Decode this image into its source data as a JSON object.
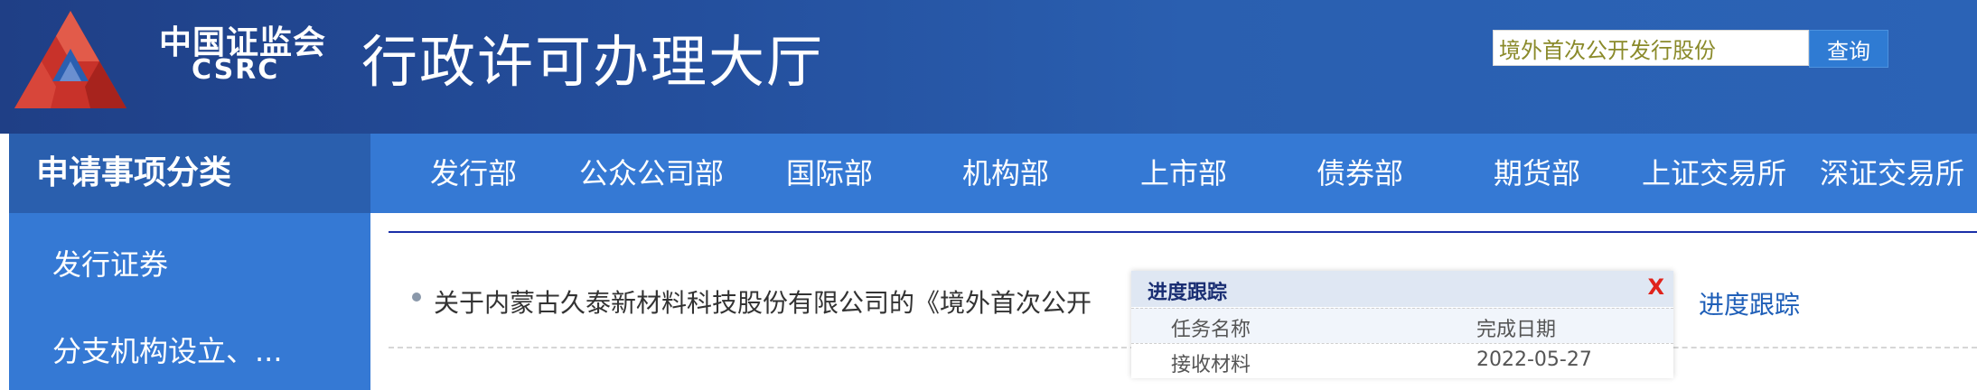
{
  "header": {
    "logo_cn": "中国证监会",
    "logo_en": "CSRC",
    "site_title": "行政许可办理大厅",
    "search": {
      "value": "境外首次公开发行股份",
      "button_label": "查询"
    }
  },
  "sidebar": {
    "title": "申请事项分类",
    "items": [
      {
        "label": "发行证券"
      },
      {
        "label": "分支机构设立、..."
      }
    ]
  },
  "nav": {
    "items": [
      {
        "label": "发行部"
      },
      {
        "label": "公众公司部"
      },
      {
        "label": "国际部"
      },
      {
        "label": "机构部"
      },
      {
        "label": "上市部"
      },
      {
        "label": "债券部"
      },
      {
        "label": "期货部"
      },
      {
        "label": "上证交易所"
      },
      {
        "label": "深证交易所"
      }
    ]
  },
  "content": {
    "item_title": "关于内蒙古久泰新材料科技股份有限公司的《境外首次公开",
    "track_link": "进度跟踪"
  },
  "popup": {
    "title": "进度跟踪",
    "close_label": "X",
    "columns": {
      "task": "任务名称",
      "date": "完成日期"
    },
    "rows": [
      {
        "task": "接收材料",
        "date": "2022-05-27"
      }
    ]
  },
  "colors": {
    "header_dark": "#1f3f86",
    "nav_blue": "#3579d4",
    "sidebar_title_blue": "#2a5fae",
    "link_blue": "#1f5fb8",
    "close_red": "#e0231b"
  }
}
